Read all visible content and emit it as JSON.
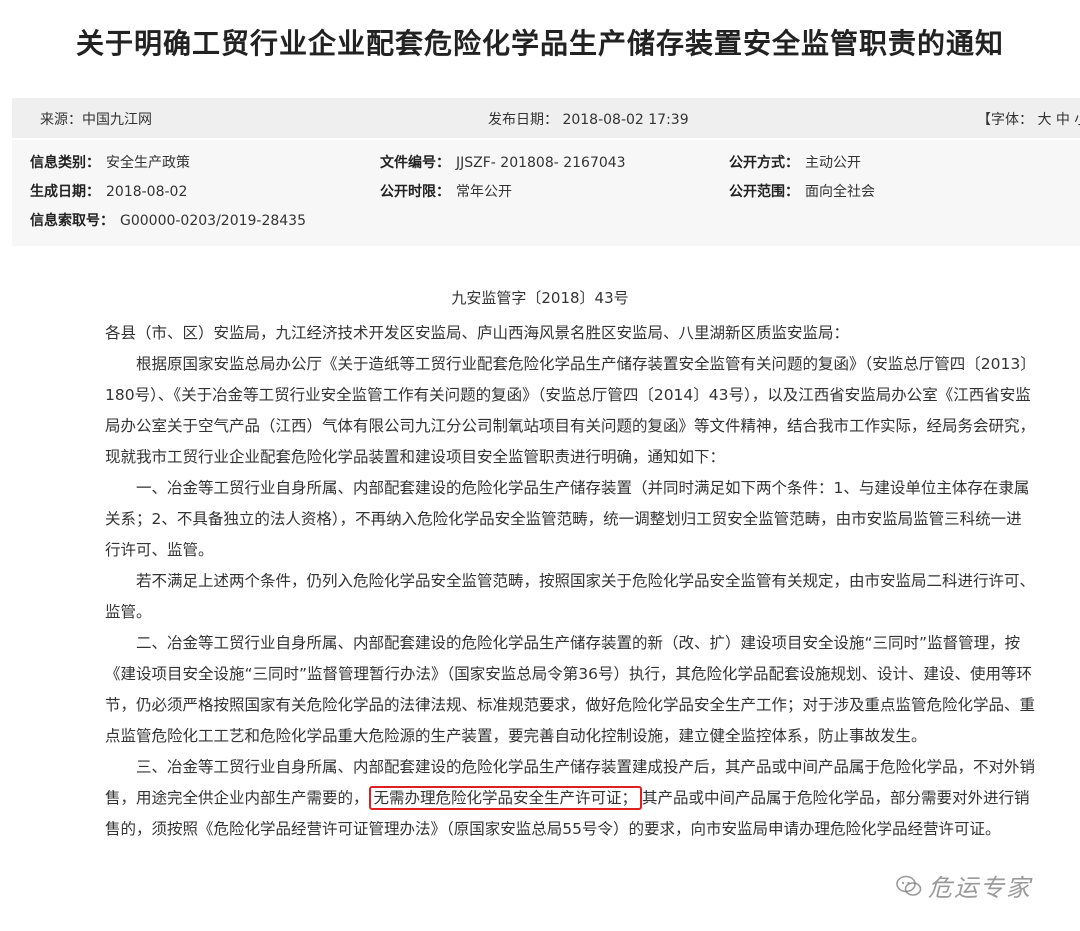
{
  "title": "关于明确工贸行业企业配套危险化学品生产储存装置安全监管职责的通知",
  "meta_bar": {
    "source": "来源：中国九江网",
    "publish_date": "发布日期： 2018-08-02 17:39",
    "font_size": "【字体： 大 中 小"
  },
  "info": {
    "category_label": "信息类别：",
    "category_value": "安全生产政策",
    "file_no_label": "文件编号：",
    "file_no_value": "JJSZF- 201808- 2167043",
    "public_mode_label": "公开方式：",
    "public_mode_value": "主动公开",
    "gen_date_label": "生成日期：",
    "gen_date_value": "2018-08-02",
    "public_limit_label": "公开时限：",
    "public_limit_value": "常年公开",
    "public_scope_label": "公开范围：",
    "public_scope_value": "面向全社会",
    "index_label": "信息索取号：",
    "index_value": "G00000-0203/2019-28435"
  },
  "doc_no": "九安监管字〔2018〕43号",
  "body": {
    "salutation": "各县（市、区）安监局，九江经济技术开发区安监局、庐山西海风景名胜区安监局、八里湖新区质监安监局：",
    "p1": "根据原国家安监总局办公厅《关于造纸等工贸行业配套危险化学品生产储存装置安全监管有关问题的复函》（安监总厅管四〔2013〕180号）、《关于冶金等工贸行业安全监管工作有关问题的复函》（安监总厅管四〔2014〕43号），以及江西省安监局办公室《江西省安监局办公室关于空气产品（江西）气体有限公司九江分公司制氧站项目有关问题的复函》等文件精神，结合我市工作实际，经局务会研究，现就我市工贸行业企业配套危险化学品装置和建设项目安全监管职责进行明确，通知如下：",
    "p2": "一、冶金等工贸行业自身所属、内部配套建设的危险化学品生产储存装置（并同时满足如下两个条件：1、与建设单位主体存在隶属关系；2、不具备独立的法人资格），不再纳入危险化学品安全监管范畴，统一调整划归工贸安全监管范畴，由市安监局监管三科统一进行许可、监管。",
    "p3": "若不满足上述两个条件，仍列入危险化学品安全监管范畴，按照国家关于危险化学品安全监管有关规定，由市安监局二科进行许可、监管。",
    "p4": "二、冶金等工贸行业自身所属、内部配套建设的危险化学品生产储存装置的新（改、扩）建设项目安全设施“三同时”监督管理，按《建设项目安全设施“三同时”监督管理暂行办法》（国家安监总局令第36号）执行，其危险化学品配套设施规划、设计、建设、使用等环节，仍必须严格按照国家有关危险化学品的法律法规、标准规范要求，做好危险化学品安全生产工作；对于涉及重点监管危险化学品、重点监管危险化工工艺和危险化学品重大危险源的生产装置，要完善自动化控制设施，建立健全监控体系，防止事故发生。",
    "p5_before": "三、冶金等工贸行业自身所属、内部配套建设的危险化学品生产储存装置建成投产后，其产品或中间产品属于危险化学品，不对外销售，用途完全供企业内部生产需要的，",
    "p5_highlight": "无需办理危险化学品安全生产许可证；",
    "p5_after": "其产品或中间产品属于危险化学品，部分需要对外进行销售的，须按照《危险化学品经营许可证管理办法》（原国家安监总局55号令）的要求，向市安监局申请办理危险化学品经营许可证。"
  },
  "watermark": {
    "text": "危运专家",
    "icon": "wechat-icon"
  },
  "colors": {
    "highlight_border": "#e02020",
    "meta_bar_bg": "#efefef",
    "info_bg": "#f7f7f7"
  }
}
